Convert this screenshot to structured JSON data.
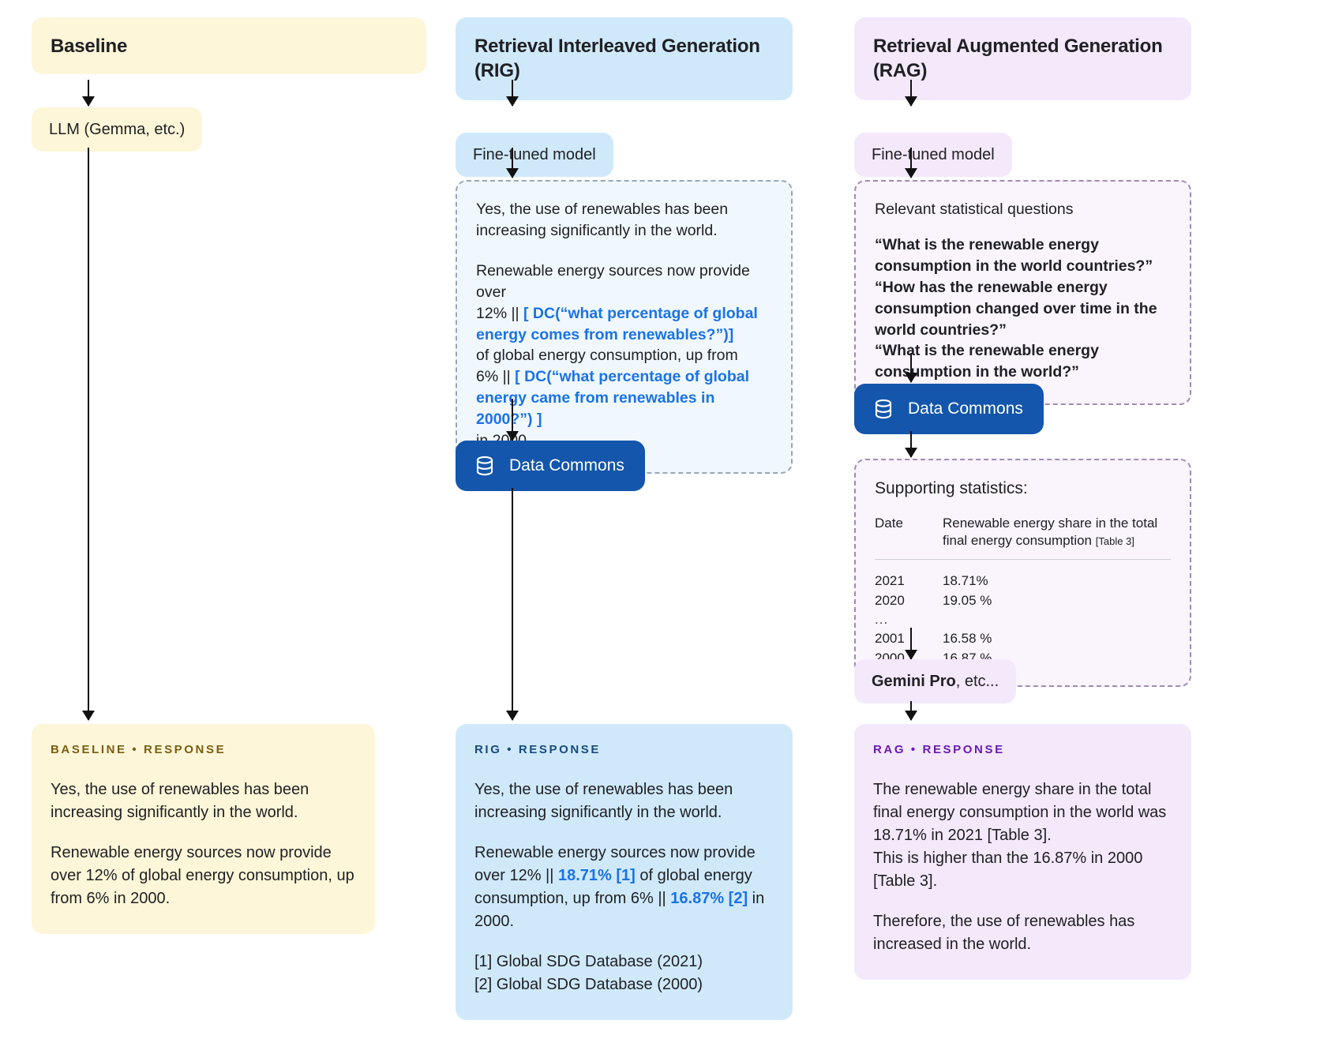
{
  "columns": {
    "baseline": {
      "header": "Baseline",
      "model_pill": "LLM (Gemma, etc.)",
      "response_label": "BASELINE • RESPONSE",
      "response_paragraphs": [
        "Yes, the use of renewables has been increasing significantly in the world.",
        "Renewable energy sources now provide over 12% of global energy consumption, up from 6%  in 2000."
      ]
    },
    "rig": {
      "header": "Retrieval Interleaved Generation (RIG)",
      "model_pill": "Fine-tuned model",
      "draft": {
        "p1": "Yes, the use of renewables has been increasing significantly in the world.",
        "l1": "Renewable energy sources now provide over",
        "l2_plain": "12% || ",
        "l2_blue": "[ DC(“what percentage of global energy comes from renewables?”)]",
        "l3": "of global energy consumption, up from",
        "l4_plain": "6% || ",
        "l4_blue": "[ DC(“what percentage of global energy came from renewables in 2000?”) ]",
        "l5": "in 2000."
      },
      "data_commons_label": "Data Commons",
      "response_label": "RIG • RESPONSE",
      "response": {
        "p1": "Yes, the use of renewables has been increasing significantly in the world.",
        "p2_a": "Renewable energy sources now provide over 12% || ",
        "p2_stat1": "18.71% [1]",
        "p2_b": " of global energy consumption, up from 6% || ",
        "p2_stat2": "16.87% [2]",
        "p2_c": " in 2000.",
        "footnote1": "[1]  Global SDG Database (2021)",
        "footnote2": "[2] Global SDG Database (2000)"
      }
    },
    "rag": {
      "header": "Retrieval Augmented Generation (RAG)",
      "model_pill": "Fine-tuned model",
      "questions_title": "Relevant statistical questions",
      "questions": [
        "“What is the renewable energy consumption in the world countries?”",
        "“How has the renewable energy consumption changed over time in the world countries?”",
        "“What is the renewable energy consumption in the world?”"
      ],
      "data_commons_label": "Data Commons",
      "stats": {
        "title": "Supporting statistics:",
        "col1_header": "Date",
        "col2_header": "Renewable energy share in the total final energy consumption",
        "col2_header_note": "[Table 3]",
        "rows": [
          {
            "date": "2021",
            "value": "18.71%"
          },
          {
            "date": "2020",
            "value": "19.05 %"
          },
          {
            "date": "...",
            "value": ""
          },
          {
            "date": "2001",
            "value": "16.58 %"
          },
          {
            "date": "2000",
            "value": "16.87 %"
          }
        ]
      },
      "model_pill2_bold": "Gemini Pro",
      "model_pill2_rest": ", etc...",
      "response_label": "RAG • RESPONSE",
      "response_paragraphs": [
        "The renewable energy share in the total final energy consumption in the world was 18.71% in 2021 [Table 3].\nThis is higher than the 16.87% in 2000 [Table 3].",
        "Therefore, the use of renewables has increased in the world."
      ]
    }
  },
  "icons": {
    "database": "database-icon"
  },
  "colors": {
    "baseline_bg": "#fdf6d8",
    "rig_bg": "#cfe9fb",
    "rag_bg": "#f4e8fb",
    "data_commons_blue": "#1356ab",
    "accent_blue": "#1a73e8"
  }
}
